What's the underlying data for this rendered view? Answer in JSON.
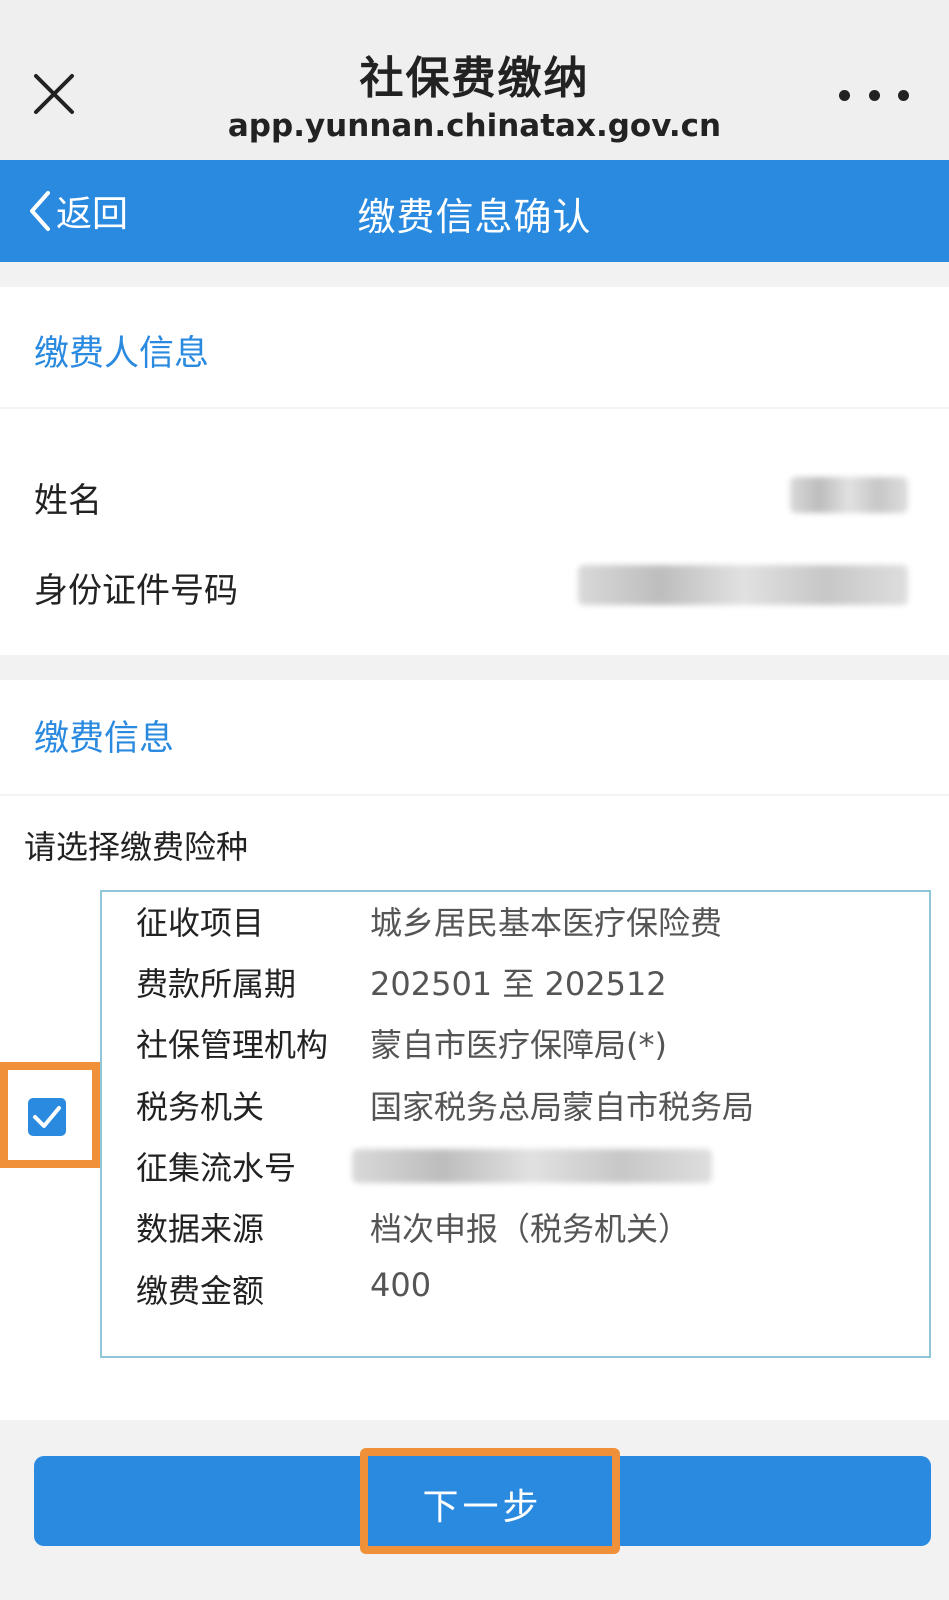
{
  "browser": {
    "title": "社保费缴纳",
    "url": "app.yunnan.chinatax.gov.cn"
  },
  "nav": {
    "back_label": "返回",
    "title": "缴费信息确认"
  },
  "payer_section": {
    "heading": "缴费人信息",
    "fields": [
      {
        "label": "姓名"
      },
      {
        "label": "身份证件号码"
      }
    ]
  },
  "payment_section": {
    "heading": "缴费信息",
    "prompt": "请选择缴费险种",
    "selected": true,
    "details": [
      {
        "key": "征收项目",
        "value": "城乡居民基本医疗保险费"
      },
      {
        "key": "费款所属期",
        "value": "202501 至 202512"
      },
      {
        "key": "社保管理机构",
        "value": "蒙自市医疗保障局(*)"
      },
      {
        "key": "税务机关",
        "value": "国家税务总局蒙自市税务局"
      },
      {
        "key": "征集流水号",
        "value": ""
      },
      {
        "key": "数据来源",
        "value": "档次申报（税务机关）"
      },
      {
        "key": "缴费金额",
        "value": "400"
      }
    ]
  },
  "actions": {
    "next_label": "下一步"
  },
  "colors": {
    "primary": "#2a8ae0",
    "highlight": "#f0913a",
    "card_border": "#8fc6d8"
  }
}
